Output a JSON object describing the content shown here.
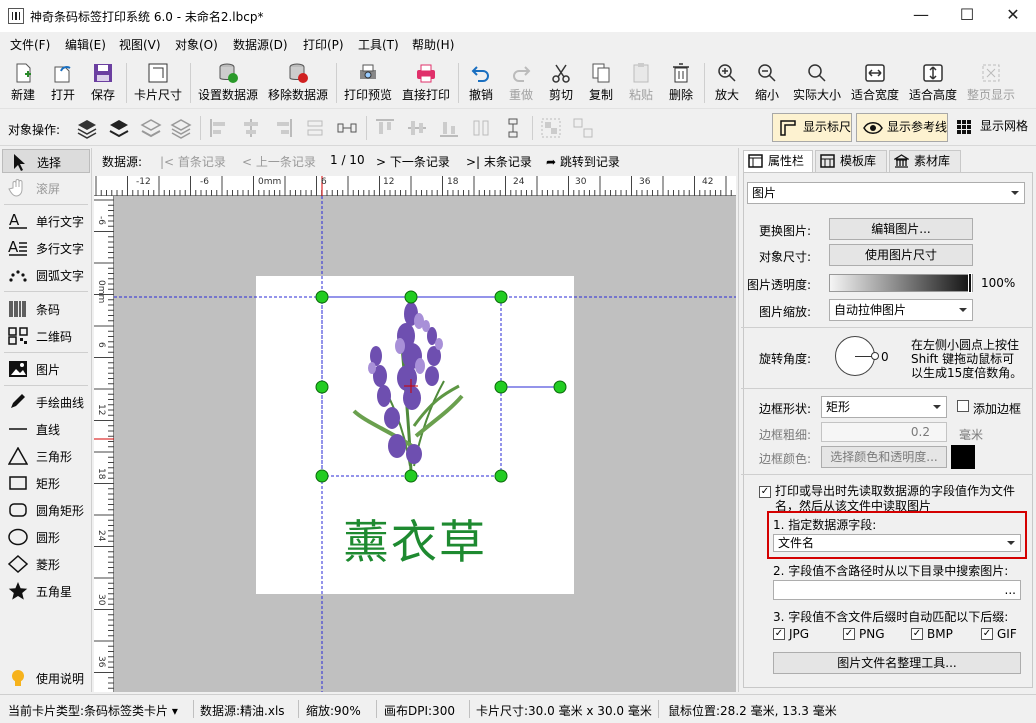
{
  "window": {
    "title": "神奇条码标签打印系统 6.0 - 未命名2.lbcp*",
    "minimize": "—",
    "maximize": "☐",
    "close": "✕"
  },
  "menu": [
    "文件(F)",
    "编辑(E)",
    "视图(V)",
    "对象(O)",
    "数据源(D)",
    "打印(P)",
    "工具(T)",
    "帮助(H)"
  ],
  "toolbar": {
    "new": "新建",
    "open": "打开",
    "save": "保存",
    "card_size": "卡片尺寸",
    "set_datasource": "设置数据源",
    "remove_datasource": "移除数据源",
    "print_preview": "打印预览",
    "direct_print": "直接打印",
    "undo": "撤销",
    "redo": "重做",
    "cut": "剪切",
    "copy": "复制",
    "paste": "粘贴",
    "delete": "删除",
    "zoom_in": "放大",
    "zoom_out": "缩小",
    "actual_size": "实际大小",
    "fit_width": "适合宽度",
    "fit_height": "适合高度",
    "fit_page": "整页显示"
  },
  "objbar": {
    "label": "对象操作:",
    "show_ruler": "显示标尺",
    "show_guides": "显示参考线",
    "show_grid": "显示网格"
  },
  "tools": {
    "select": "选择",
    "scroll": "滚屏",
    "single_text": "单行文字",
    "multi_text": "多行文字",
    "arc_text": "圆弧文字",
    "barcode": "条码",
    "qrcode": "二维码",
    "image": "图片",
    "freehand": "手绘曲线",
    "line": "直线",
    "triangle": "三角形",
    "rectangle": "矩形",
    "rounded_rect": "圆角矩形",
    "circle": "圆形",
    "diamond": "菱形",
    "star": "五角星",
    "help": "使用说明"
  },
  "recordbar": {
    "label": "数据源:",
    "first": "首条记录",
    "prev": "上一条记录",
    "counter": "1 / 10",
    "next": "下一条记录",
    "last": "末条记录",
    "jump": "跳转到记录"
  },
  "ruler": {
    "top_ticks": [
      "-12",
      "-6",
      "0mm",
      "6",
      "12",
      "18",
      "24",
      "30",
      "36",
      "42"
    ],
    "left_ticks": [
      "-6",
      "0mm",
      "6",
      "12",
      "18",
      "24",
      "30",
      "36"
    ]
  },
  "card": {
    "text": "薰衣草",
    "text_color": "#1e8a30"
  },
  "panel": {
    "tabs": [
      "属性栏",
      "模板库",
      "素材库"
    ],
    "object_type": "图片",
    "change_image_label": "更换图片:",
    "edit_image_btn": "编辑图片...",
    "object_size_label": "对象尺寸:",
    "use_image_size_btn": "使用图片尺寸",
    "opacity_label": "图片透明度:",
    "opacity_value": "100%",
    "opacity": 1.0,
    "scale_label": "图片缩放:",
    "scale_value": "自动拉伸图片",
    "rotation_label": "旋转角度:",
    "rotation_value": "0",
    "rotation_hint": [
      "在左侧小圆点上按住",
      "Shift 键拖动鼠标可",
      "以生成15度倍数角。"
    ],
    "border_shape_label": "边框形状:",
    "border_shape_value": "矩形",
    "add_border": "添加边框",
    "add_border_checked": false,
    "border_width_label": "边框粗细:",
    "border_width_value": "0.2",
    "border_width_unit": "毫米",
    "border_color_label": "边框颜色:",
    "border_color_btn": "选择颜色和透明度...",
    "border_color": "#000000",
    "read_from_ds": [
      "打印或导出时先读取数据源的字段值作为文件",
      "名，然后从该文件中读取图片"
    ],
    "read_from_ds_checked": true,
    "step1_label": "1. 指定数据源字段:",
    "step1_value": "文件名",
    "step2_label": "2. 字段值不含路径时从以下目录中搜索图片:",
    "step2_btn": "...",
    "step3_label": "3. 字段值不含文件后缀时自动匹配以下后缀:",
    "exts": [
      "JPG",
      "PNG",
      "BMP",
      "GIF"
    ],
    "organize_btn": "图片文件名整理工具..."
  },
  "status": {
    "card_type": "当前卡片类型:条码标签类卡片",
    "datasource": "数据源:精油.xls",
    "zoom": "缩放:90%",
    "dpi": "画布DPI:300",
    "card_size": "卡片尺寸:30.0 毫米 x 30.0 毫米",
    "mouse": "鼠标位置:28.2 毫米, 13.3 毫米"
  },
  "colors": {
    "accent": "#0078d7",
    "handle": "#22cc22",
    "guide": "#2a2ad6",
    "highlight": "#d40000"
  }
}
